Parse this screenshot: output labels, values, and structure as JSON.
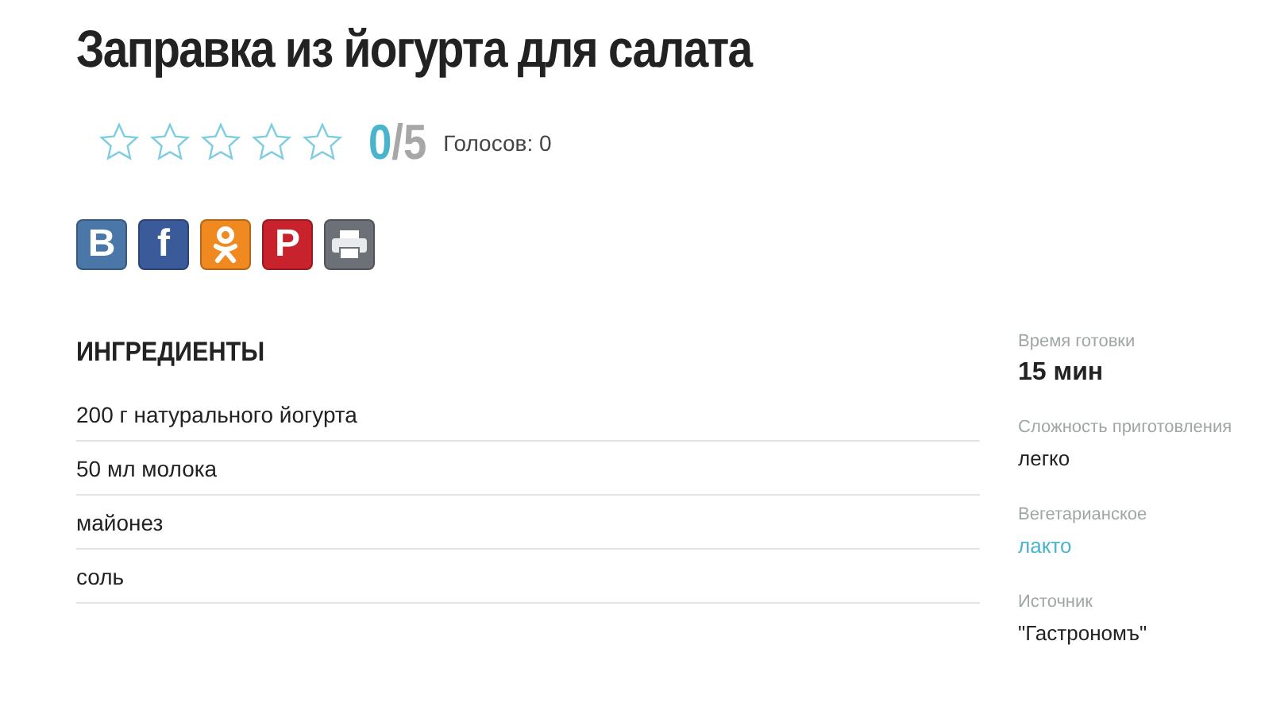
{
  "title": "Заправка из йогурта для салата",
  "rating": {
    "stars": 0,
    "score": "0",
    "out_of": "/5",
    "votes": "Голосов: 0"
  },
  "share_buttons": [
    {
      "kind": "letter",
      "glyph": "B",
      "color": "#4a77a8"
    },
    {
      "kind": "letter",
      "glyph": "f",
      "color": "#3b5a9a"
    },
    {
      "kind": "ok",
      "color": "#f08a20"
    },
    {
      "kind": "letter",
      "glyph": "P",
      "color": "#c8232c"
    },
    {
      "kind": "print",
      "color": "#6b7176"
    }
  ],
  "ingredients": {
    "heading": "ИНГРЕДИЕНТЫ",
    "items": [
      "200 г натурального йогурта",
      "50 мл молока",
      "майонез",
      "соль"
    ]
  },
  "details": [
    {
      "label": "Время готовки",
      "value": "15 мин",
      "kind": "big"
    },
    {
      "label": "Сложность приготовления",
      "value": "легко",
      "kind": "plain"
    },
    {
      "label": "Вегетарианское",
      "value": "лакто",
      "kind": "link"
    },
    {
      "label": "Источник",
      "value": "\"Гастрономъ\"",
      "kind": "plain"
    }
  ]
}
